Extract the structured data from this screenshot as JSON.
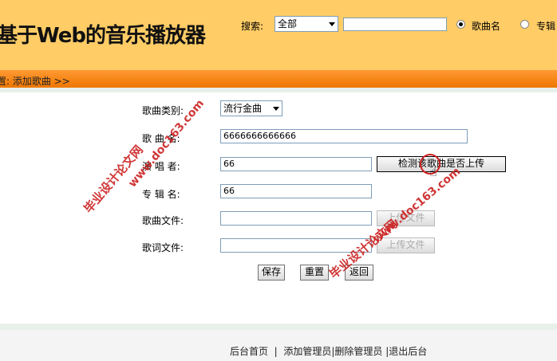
{
  "header": {
    "title": "基于Web的音乐播放器",
    "search_label": "搜索:",
    "search_select_value": "全部",
    "search_value": "",
    "radio_song": "歌曲名",
    "radio_album": "专辑"
  },
  "breadcrumb": "置: 添加歌曲 >>",
  "form": {
    "category_label": "歌曲类别:",
    "category_value": "流行金曲",
    "song_label": "歌 曲 名:",
    "song_value": "6666666666666",
    "singer_label": "演 唱 者:",
    "singer_value": "66",
    "check_button": "检测该歌曲是否上传",
    "album_label": "专 辑 名:",
    "album_value": "66",
    "song_file_label": "歌曲文件:",
    "lyric_file_label": "歌词文件:",
    "upload_button": "上传文件",
    "save_button": "保存",
    "reset_button": "重置",
    "back_button": "返回"
  },
  "footer": {
    "home": "后台首页",
    "sep1": "|",
    "add_admin": "添加管理员",
    "sep2": "|",
    "delete_admin": "删除管理员",
    "sep3": "|",
    "logout": "退出后台"
  },
  "watermark": {
    "site_name": "毕业设计论文网",
    "site_url": "www.doc163.com"
  },
  "colors": {
    "header_bg": "#ffcc66",
    "nav_bar": "#ee7700",
    "watermark": "#cc2222"
  }
}
